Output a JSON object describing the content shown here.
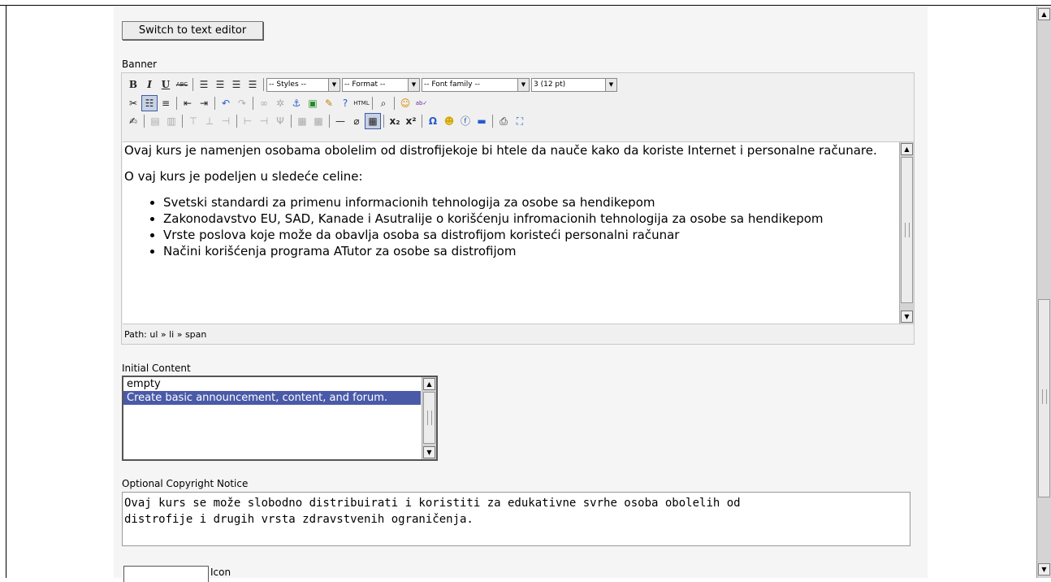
{
  "switch_button": "Switch to text editor",
  "banner_label": "Banner",
  "toolbar": {
    "styles": "-- Styles --",
    "format": "-- Format --",
    "font_family": "-- Font family --",
    "font_size": "3 (12 pt)",
    "html_label": "HTML"
  },
  "editor": {
    "p1": "Ovaj kurs je namenjen osobama obolelim od distrofijekoje bi htele da nauče kako da koriste Internet i personalne računare.",
    "p2": "O vaj kurs je podeljen u sledeće celine:",
    "bullets": [
      "Svetski standardi za  primenu informacionih tehnologija za osobe sa hendikepom",
      "Zakonodavstvo EU, SAD, Kanade i Asutralije o korišćenju infromacionih tehnologija za osobe sa hendikepom",
      "Vrste poslova koje može da obavlja osoba sa distrofijom koristeći personalni računar",
      "Načini korišćenja programa ATutor za osobe sa distrofijom"
    ],
    "path": "Path: ul » li » span"
  },
  "initial_content": {
    "label": "Initial Content",
    "options": [
      "empty",
      "Create basic announcement, content, and forum."
    ],
    "selected_index": 1
  },
  "copyright": {
    "label": "Optional Copyright Notice",
    "value": "Ovaj kurs se može slobodno distribuirati i koristiti za edukativne svrhe osoba obolelih od\ndistrofije i drugih vrsta zdravstvenih ograničenja."
  },
  "icon_label": "Icon",
  "colors": {
    "selected_option_bg": "#4a5aa8",
    "content_bg": "#f5f5f5"
  }
}
